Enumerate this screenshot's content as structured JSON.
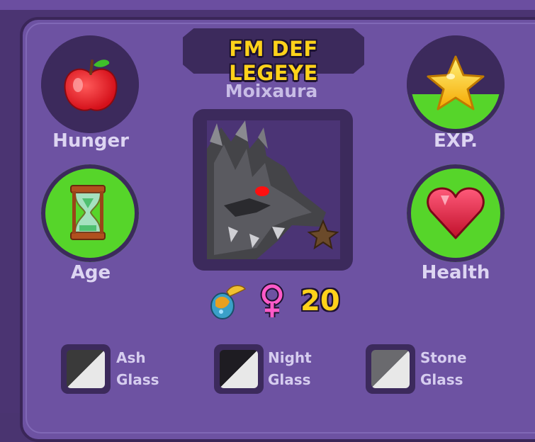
{
  "title": "FM DEF LEGEYE",
  "pet_name": "Moixaura",
  "stats": {
    "hunger": {
      "label": "Hunger",
      "icon": "apple-icon",
      "fill": 0
    },
    "exp": {
      "label": "EXP.",
      "icon": "star-icon",
      "fill": 0.4
    },
    "age": {
      "label": "Age",
      "icon": "hourglass-icon",
      "fill": 1
    },
    "health": {
      "label": "Health",
      "icon": "heart-icon",
      "fill": 1
    }
  },
  "level": "20",
  "colors": {
    "accent_yellow": "#ffd21a",
    "stat_green": "#56d52a",
    "panel": "#6d52a2",
    "dark": "#3c2a5c"
  },
  "swatches": [
    {
      "line1": "Ash",
      "line2": "Glass",
      "dark": "#3a3a3a",
      "light": "#e8e8e8"
    },
    {
      "line1": "Night",
      "line2": "Glass",
      "dark": "#1e1c22",
      "light": "#e8e8e8"
    },
    {
      "line1": "Stone",
      "line2": "Glass",
      "dark": "#6a6a6e",
      "light": "#e8e8e8"
    }
  ]
}
